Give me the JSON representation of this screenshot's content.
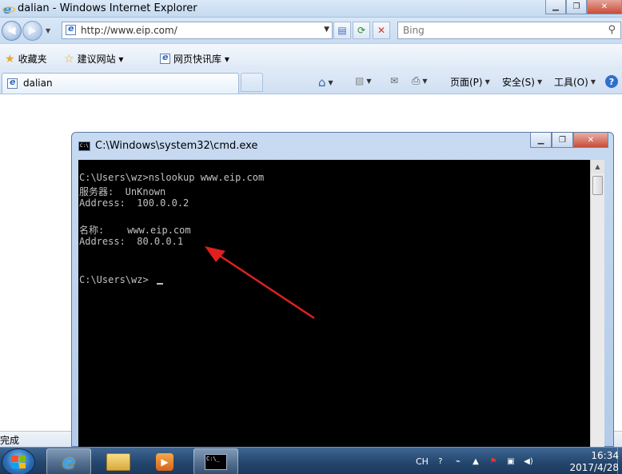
{
  "ie": {
    "window_title": "dalian - Windows Internet Explorer",
    "address": "http://www.eip.com/",
    "search_placeholder": "Bing",
    "favorites_label": "收藏夹",
    "fav_items": [
      "建议网站 ▾",
      "网页快讯库 ▾"
    ],
    "tab_title": "dalian",
    "commands": {
      "page": "页面(P)",
      "safety": "安全(S)",
      "tools": "工具(O)"
    },
    "status_text": "完成"
  },
  "cmd": {
    "window_title": "C:\\Windows\\system32\\cmd.exe",
    "lines": [
      "C:\\Users\\wz>nslookup www.eip.com",
      "服务器:  UnKnown",
      "Address:  100.0.0.2",
      "",
      "名称:    www.eip.com",
      "Address:  80.0.0.1",
      "",
      "",
      "C:\\Users\\wz>"
    ]
  },
  "taskbar": {
    "tray_lang": "CH",
    "time": "16:34",
    "date": "2017/4/28"
  },
  "colors": {
    "annotation_arrow": "#e02020",
    "console_text": "#c0c0c0",
    "console_bg": "#000000"
  }
}
